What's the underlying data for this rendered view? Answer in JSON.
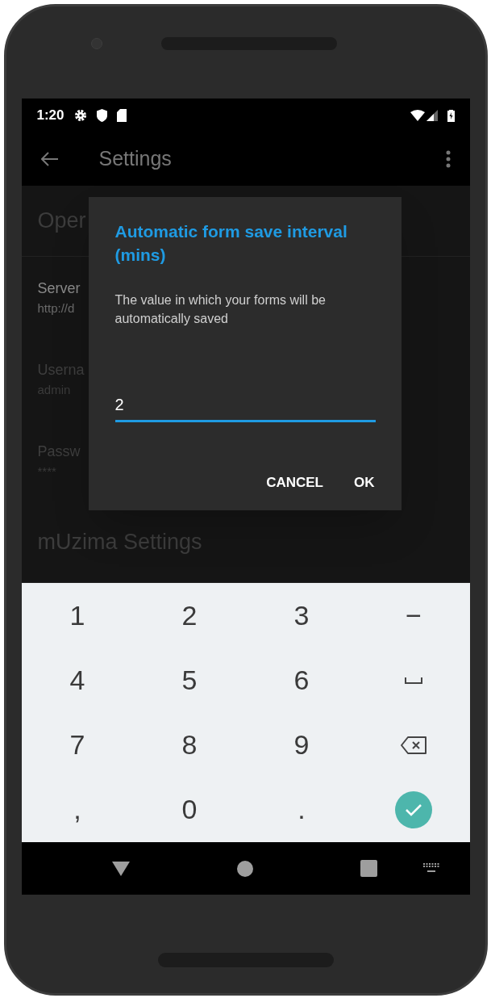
{
  "status_bar": {
    "time": "1:20"
  },
  "toolbar": {
    "title": "Settings"
  },
  "settings": {
    "header": "Oper",
    "items": [
      {
        "title": "Server",
        "summary": "http://d",
        "disabled": false
      },
      {
        "title": "Userna",
        "summary": "admin",
        "disabled": true
      },
      {
        "title": "Passw",
        "summary": "****",
        "disabled": true
      }
    ],
    "section_header": "mUzima Settings"
  },
  "dialog": {
    "title": "Automatic form save interval (mins)",
    "message": "The value in which your forms will be automatically saved",
    "value": "2",
    "buttons": [
      "CANCEL",
      "OK"
    ]
  },
  "keyboard": {
    "rows": [
      [
        {
          "kind": "text",
          "label": "1"
        },
        {
          "kind": "text",
          "label": "2"
        },
        {
          "kind": "text",
          "label": "3"
        },
        {
          "kind": "text",
          "label": "−"
        }
      ],
      [
        {
          "kind": "text",
          "label": "4"
        },
        {
          "kind": "text",
          "label": "5"
        },
        {
          "kind": "text",
          "label": "6"
        },
        {
          "kind": "space"
        }
      ],
      [
        {
          "kind": "text",
          "label": "7"
        },
        {
          "kind": "text",
          "label": "8"
        },
        {
          "kind": "text",
          "label": "9"
        },
        {
          "kind": "backspace"
        }
      ],
      [
        {
          "kind": "text",
          "label": ","
        },
        {
          "kind": "text",
          "label": "0"
        },
        {
          "kind": "text",
          "label": "."
        },
        {
          "kind": "done"
        }
      ]
    ]
  }
}
